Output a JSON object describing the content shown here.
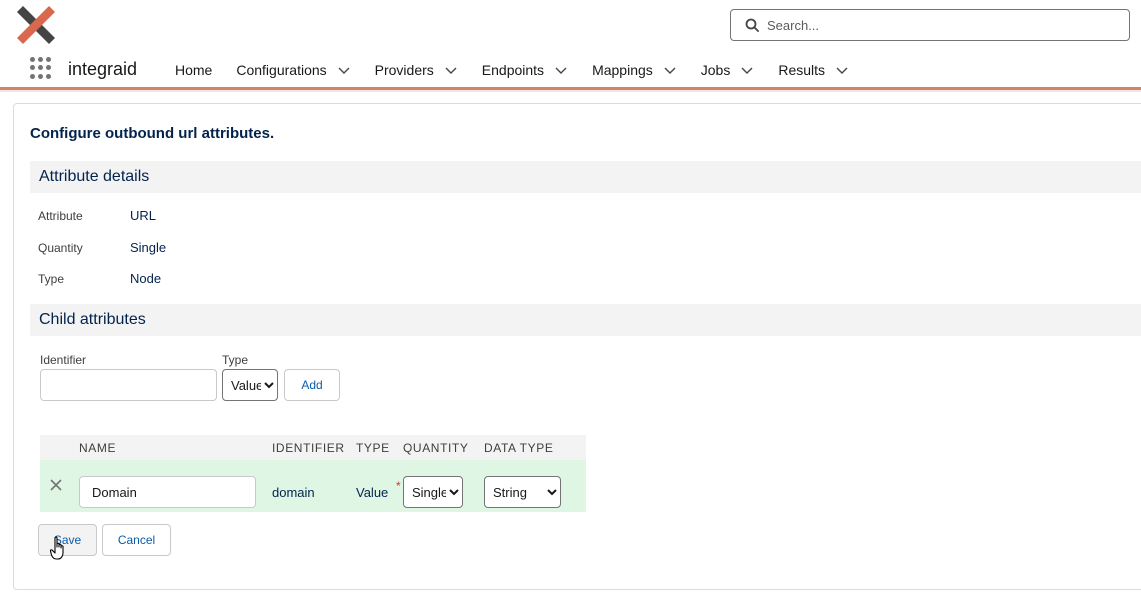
{
  "header": {
    "app_name": "integraid",
    "search_placeholder": "Search...",
    "brand_colors": {
      "logo_primary": "#d9684e",
      "logo_secondary": "#444444",
      "accent": "#d88068"
    }
  },
  "nav": {
    "items": [
      {
        "label": "Home",
        "has_menu": false
      },
      {
        "label": "Configurations",
        "has_menu": true
      },
      {
        "label": "Providers",
        "has_menu": true
      },
      {
        "label": "Endpoints",
        "has_menu": true
      },
      {
        "label": "Mappings",
        "has_menu": true
      },
      {
        "label": "Jobs",
        "has_menu": true
      },
      {
        "label": "Results",
        "has_menu": true
      }
    ]
  },
  "page": {
    "title": "Configure outbound url attributes.",
    "details_header": "Attribute details",
    "details": [
      {
        "label": "Attribute",
        "value": "URL"
      },
      {
        "label": "Quantity",
        "value": "Single"
      },
      {
        "label": "Type",
        "value": "Node"
      }
    ],
    "child_header": "Child attributes",
    "form": {
      "identifier_label": "Identifier",
      "identifier_value": "",
      "type_label": "Type",
      "type_selected": "Value",
      "add_label": "Add"
    },
    "table": {
      "columns": [
        "NAME",
        "IDENTIFIER",
        "TYPE",
        "QUANTITY",
        "DATA TYPE"
      ],
      "rows": [
        {
          "name": "Domain",
          "identifier": "domain",
          "type": "Value",
          "required_mark": "*",
          "quantity": "Single",
          "data_type": "String"
        }
      ]
    },
    "save_label": "Save",
    "cancel_label": "Cancel"
  }
}
